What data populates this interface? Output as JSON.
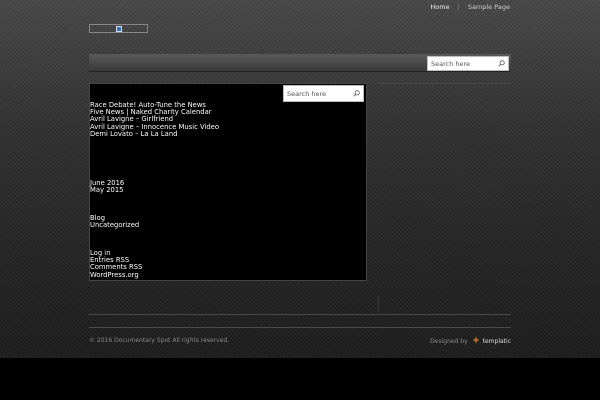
{
  "top_nav": {
    "home_label": "Home",
    "separator": "|",
    "sample_page_label": "Sample Page"
  },
  "header": {
    "search_placeholder": "Search here"
  },
  "sidebar": {
    "search_placeholder": "Search here",
    "recent_posts": [
      "Race Debate! Auto-Tune the News",
      "Five News | Naked Charity Calendar",
      "Avril Lavigne – Girlfriend",
      "Avril Lavigne – Innocence Music Video",
      "Demi Lovato – La La Land"
    ],
    "archives": [
      "June 2016",
      "May 2015"
    ],
    "categories": [
      "Blog",
      "Uncategorized"
    ],
    "meta": [
      "Log in",
      "Entries RSS",
      "Comments RSS",
      "WordPress.org"
    ]
  },
  "footer": {
    "copyright": "© 2016 Documentary Spot All rights reserved.",
    "designed_by": "Designed by",
    "brand": "templatic"
  },
  "colors": {
    "background": "#000000",
    "header_bar": "#4a4a4a",
    "link": "#ffffff"
  }
}
